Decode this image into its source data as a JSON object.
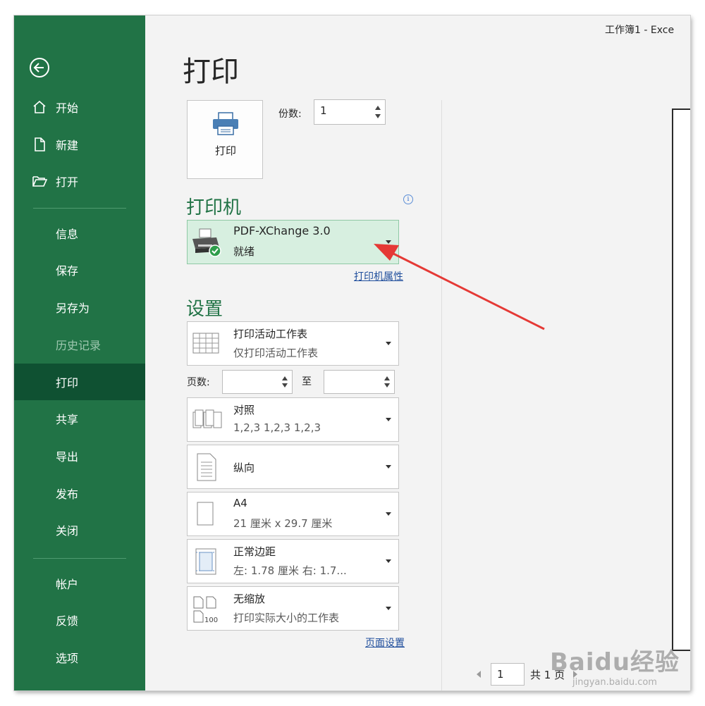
{
  "window": {
    "title": "工作簿1  -  Exce"
  },
  "sidebar": {
    "items": [
      {
        "label": "开始",
        "icon": "home-icon"
      },
      {
        "label": "新建",
        "icon": "new-document-icon"
      },
      {
        "label": "打开",
        "icon": "open-folder-icon"
      },
      {
        "label": "信息"
      },
      {
        "label": "保存"
      },
      {
        "label": "另存为"
      },
      {
        "label": "历史记录",
        "disabled": true
      },
      {
        "label": "打印",
        "active": true
      },
      {
        "label": "共享"
      },
      {
        "label": "导出"
      },
      {
        "label": "发布"
      },
      {
        "label": "关闭"
      },
      {
        "label": "帐户"
      },
      {
        "label": "反馈"
      },
      {
        "label": "选项"
      }
    ]
  },
  "main": {
    "title": "打印",
    "print_button_label": "打印",
    "copies": {
      "label": "份数:",
      "value": "1"
    },
    "printer_section": {
      "title": "打印机",
      "name": "PDF-XChange 3.0",
      "status": "就绪",
      "properties_link": "打印机属性"
    },
    "settings_section": {
      "title": "设置",
      "what": {
        "line1": "打印活动工作表",
        "line2": "仅打印活动工作表"
      },
      "pages": {
        "label": "页数:",
        "to_label": "至",
        "from": "",
        "to": ""
      },
      "collate": {
        "line1": "对照",
        "line2": "1,2,3    1,2,3    1,2,3"
      },
      "orientation": {
        "line1": "纵向"
      },
      "paper": {
        "line1": "A4",
        "line2": "21 厘米 x 29.7 厘米"
      },
      "margins": {
        "line1": "正常边距",
        "line2": "左: 1.78 厘米    右: 1.7..."
      },
      "scaling": {
        "line1": "无缩放",
        "line2": "打印实际大小的工作表"
      },
      "page_setup_link": "页面设置"
    },
    "pager": {
      "current": "1",
      "total_text": "共 1 页"
    }
  },
  "watermark": {
    "text": "Baidu经验",
    "url": "jingyan.baidu.com"
  },
  "colors": {
    "sidebar": "#217346",
    "active": "#0f5132",
    "accent_green": "#217346",
    "printer_highlight": "#d7efe0",
    "annotation_arrow": "#e53935"
  }
}
